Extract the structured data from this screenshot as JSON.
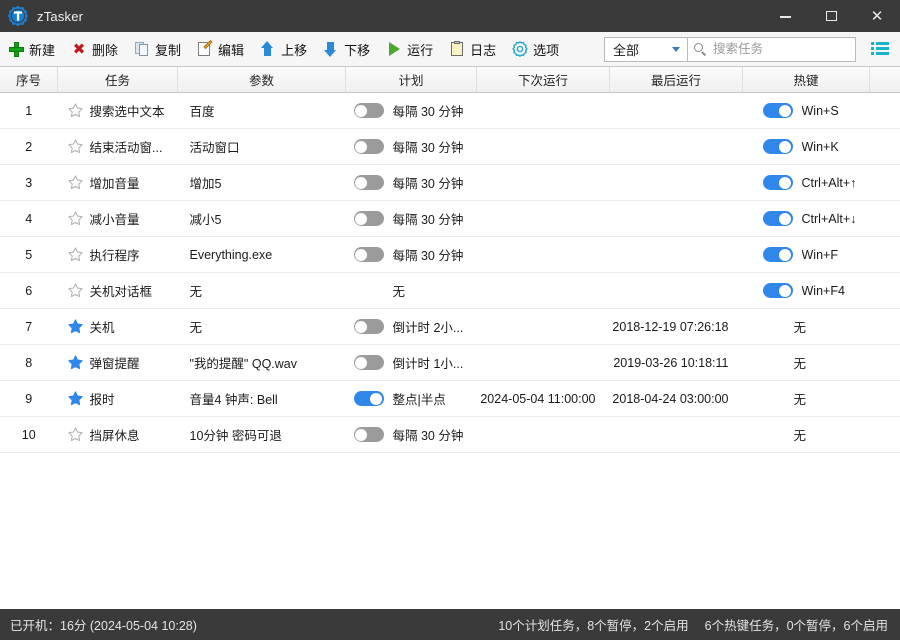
{
  "window": {
    "title": "zTasker",
    "app_icon": "ztasker-gear-icon",
    "minimize_label": "—",
    "maximize_label": "□",
    "close_label": "✕"
  },
  "toolbar": {
    "buttons": [
      {
        "id": "new",
        "label": "新建",
        "icon": "plus-icon"
      },
      {
        "id": "delete",
        "label": "删除",
        "icon": "delete-x-icon"
      },
      {
        "id": "copy",
        "label": "复制",
        "icon": "copy-icon"
      },
      {
        "id": "edit",
        "label": "编辑",
        "icon": "edit-pencil-icon"
      },
      {
        "id": "moveup",
        "label": "上移",
        "icon": "arrow-up-icon"
      },
      {
        "id": "movedown",
        "label": "下移",
        "icon": "arrow-down-icon"
      },
      {
        "id": "run",
        "label": "运行",
        "icon": "play-icon"
      },
      {
        "id": "log",
        "label": "日志",
        "icon": "clipboard-icon"
      },
      {
        "id": "options",
        "label": "选项",
        "icon": "gear-icon"
      }
    ],
    "filter": {
      "value": "全部",
      "icon": "chevron-down-icon"
    },
    "search": {
      "value": "",
      "placeholder": "搜索任务",
      "icon": "search-icon"
    },
    "view_toggle_icon": "list-view-icon"
  },
  "table": {
    "columns": [
      {
        "key": "idx",
        "label": "序号"
      },
      {
        "key": "task",
        "label": "任务"
      },
      {
        "key": "param",
        "label": "参数"
      },
      {
        "key": "plan",
        "label": "计划"
      },
      {
        "key": "next",
        "label": "下次运行"
      },
      {
        "key": "last",
        "label": "最后运行"
      },
      {
        "key": "key",
        "label": "热键"
      },
      {
        "key": "pad",
        "label": ""
      }
    ],
    "rows": [
      {
        "idx": "1",
        "starred": false,
        "task": "搜索选中文本",
        "param": "百度",
        "plan_on": false,
        "plan": "每隔 30 分钟",
        "next": "",
        "last": "",
        "key_has_toggle": true,
        "key_on": true,
        "key": "Win+S"
      },
      {
        "idx": "2",
        "starred": false,
        "task": "结束活动窗...",
        "param": "活动窗口",
        "plan_on": false,
        "plan": "每隔 30 分钟",
        "next": "",
        "last": "",
        "key_has_toggle": true,
        "key_on": true,
        "key": "Win+K"
      },
      {
        "idx": "3",
        "starred": false,
        "task": "增加音量",
        "param": "增加5",
        "plan_on": false,
        "plan": "每隔 30 分钟",
        "next": "",
        "last": "",
        "key_has_toggle": true,
        "key_on": true,
        "key": "Ctrl+Alt+↑"
      },
      {
        "idx": "4",
        "starred": false,
        "task": "减小音量",
        "param": "减小5",
        "plan_on": false,
        "plan": "每隔 30 分钟",
        "next": "",
        "last": "",
        "key_has_toggle": true,
        "key_on": true,
        "key": "Ctrl+Alt+↓"
      },
      {
        "idx": "5",
        "starred": false,
        "task": "执行程序",
        "param": "Everything.exe",
        "plan_on": false,
        "plan": "每隔 30 分钟",
        "next": "",
        "last": "",
        "key_has_toggle": true,
        "key_on": true,
        "key": "Win+F"
      },
      {
        "idx": "6",
        "starred": false,
        "task": "关机对话框",
        "param": "无",
        "plan_on": null,
        "plan": "无",
        "next": "",
        "last": "",
        "key_has_toggle": true,
        "key_on": true,
        "key": "Win+F4"
      },
      {
        "idx": "7",
        "starred": true,
        "task": "关机",
        "param": "无",
        "plan_on": false,
        "plan": "倒计时 2小...",
        "next": "",
        "last": "2018-12-19 07:26:18",
        "key_has_toggle": false,
        "key_on": null,
        "key": "无"
      },
      {
        "idx": "8",
        "starred": true,
        "task": "弹窗提醒",
        "param": "\"我的提醒\" QQ.wav",
        "plan_on": false,
        "plan": "倒计时 1小...",
        "next": "",
        "last": "2019-03-26 10:18:11",
        "key_has_toggle": false,
        "key_on": null,
        "key": "无"
      },
      {
        "idx": "9",
        "starred": true,
        "task": "报时",
        "param": "音量4 钟声: Bell",
        "plan_on": true,
        "plan": "整点|半点",
        "next": "2024-05-04 11:00:00",
        "last": "2018-04-24 03:00:00",
        "key_has_toggle": false,
        "key_on": null,
        "key": "无"
      },
      {
        "idx": "10",
        "starred": false,
        "task": "挡屏休息",
        "param": "10分钟 密码可退",
        "plan_on": false,
        "plan": "每隔 30 分钟",
        "next": "",
        "last": "",
        "key_has_toggle": false,
        "key_on": null,
        "key": "无"
      }
    ]
  },
  "statusbar": {
    "uptime": "已开机：16分 (2024-05-04 10:28)",
    "plan_summary": "10个计划任务，8个暂停，2个启用",
    "hotkey_summary": "6个热键任务，0个暂停，6个启用"
  },
  "colors": {
    "titlebar": "#3a3a3a",
    "accent_blue": "#2f87ea",
    "toggle_off": "#9b9b9b",
    "toolbar_bg": "#f6f6f6",
    "star_filled": "#2f87ea",
    "list_icon": "#17b5c9"
  }
}
